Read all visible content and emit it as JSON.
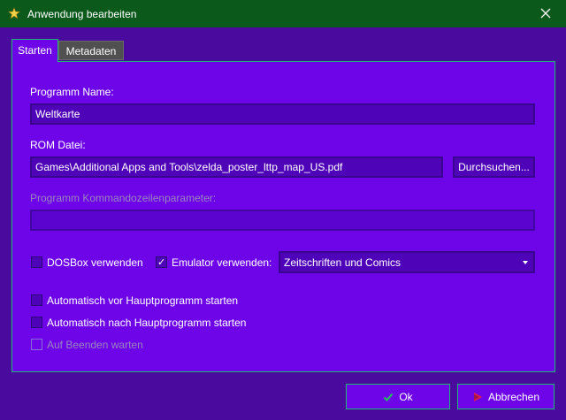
{
  "window": {
    "title": "Anwendung bearbeiten",
    "icon": "app-star-icon",
    "close_icon": "close-icon"
  },
  "tabs": [
    {
      "label": "Starten",
      "active": true
    },
    {
      "label": "Metadaten",
      "active": false
    }
  ],
  "form": {
    "program_name_label": "Programm Name:",
    "program_name_value": "Weltkarte",
    "rom_file_label": "ROM Datei:",
    "rom_file_value": "Games\\Additional Apps and Tools\\zelda_poster_lttp_map_US.pdf",
    "browse_button": "Durchsuchen...",
    "cmdline_label": "Programm Kommandozeilenparameter:",
    "cmdline_value": "",
    "dosbox_label": "DOSBox verwenden",
    "dosbox_checked": false,
    "emulator_label": "Emulator verwenden:",
    "emulator_checked": true,
    "emulator_selected": "Zeitschriften und Comics",
    "auto_before_label": "Automatisch vor Hauptprogramm starten",
    "auto_before_checked": false,
    "auto_after_label": "Automatisch nach Hauptprogramm starten",
    "auto_after_checked": false,
    "wait_exit_label": "Auf Beenden warten",
    "wait_exit_checked": false
  },
  "buttons": {
    "ok_label": "Ok",
    "cancel_label": "Abbrechen"
  },
  "colors": {
    "titlebar": "#0b5a1c",
    "background": "#4a0a9e",
    "panel": "#6d05e8",
    "accent_border": "#1fb870",
    "ok_icon": "#22c55e",
    "cancel_icon": "#e11d48"
  }
}
